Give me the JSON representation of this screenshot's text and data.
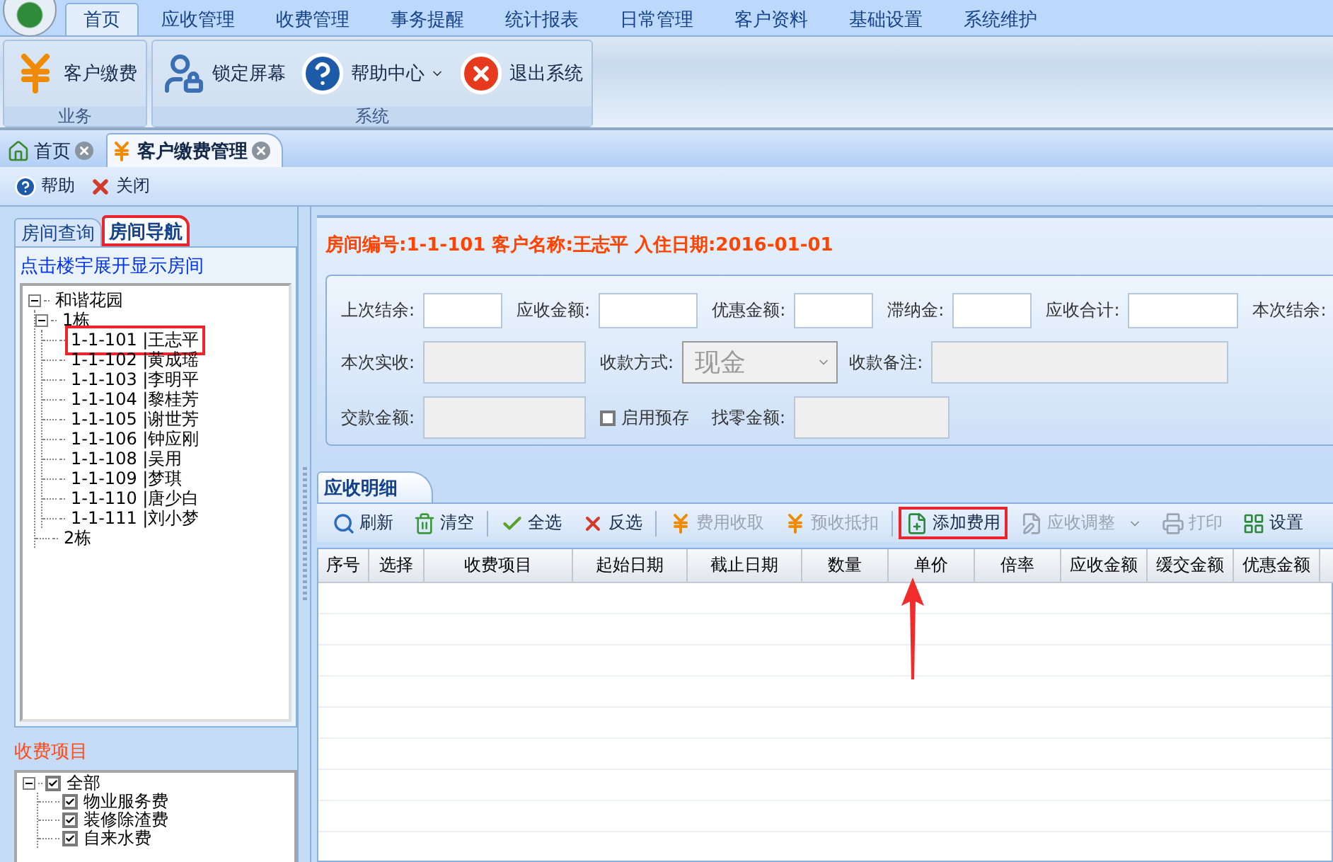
{
  "menu_tabs": [
    {
      "label": "首页",
      "selected": true
    },
    {
      "label": "应收管理",
      "selected": false
    },
    {
      "label": "收费管理",
      "selected": false
    },
    {
      "label": "事务提醒",
      "selected": false
    },
    {
      "label": "统计报表",
      "selected": false
    },
    {
      "label": "日常管理",
      "selected": false
    },
    {
      "label": "客户资料",
      "selected": false
    },
    {
      "label": "基础设置",
      "selected": false
    },
    {
      "label": "系统维护",
      "selected": false
    }
  ],
  "ribbon_groups": [
    {
      "title": "业务",
      "buttons": [
        {
          "label": "客户缴费",
          "dropdown": false
        }
      ]
    },
    {
      "title": "系统",
      "buttons": [
        {
          "label": "锁定屏幕",
          "dropdown": false
        },
        {
          "label": "帮助中心",
          "dropdown": true
        },
        {
          "label": "退出系统",
          "dropdown": false
        }
      ]
    }
  ],
  "doc_tabs": [
    {
      "label": "首页",
      "selected": false
    },
    {
      "label": "客户缴费管理",
      "selected": true
    }
  ],
  "page_toolbar": [
    {
      "label": "帮助"
    },
    {
      "label": "关闭"
    }
  ],
  "left_tabs": [
    {
      "label": "房间查询",
      "selected": false,
      "highlighted": false
    },
    {
      "label": "房间导航",
      "selected": true,
      "highlighted": true
    }
  ],
  "nav_hint": "点击楼宇展开显示房间",
  "room_tree": [
    {
      "label": "和谐花园",
      "expanded": true,
      "children": [
        {
          "label": "1栋",
          "expanded": true,
          "children": [
            {
              "label": "1-1-101 |王志平",
              "highlighted": true
            },
            {
              "label": "1-1-102 |黄成瑶",
              "highlighted": false
            },
            {
              "label": "1-1-103 |李明平",
              "highlighted": false
            },
            {
              "label": "1-1-104 |黎桂芳",
              "highlighted": false
            },
            {
              "label": "1-1-105 |谢世芳",
              "highlighted": false
            },
            {
              "label": "1-1-106 |钟应刚",
              "highlighted": false
            },
            {
              "label": "1-1-108 |吴用",
              "highlighted": false
            },
            {
              "label": "1-1-109 |梦琪",
              "highlighted": false
            },
            {
              "label": "1-1-110 |唐少白",
              "highlighted": false
            },
            {
              "label": "1-1-111 |刘小梦",
              "highlighted": false
            }
          ]
        },
        {
          "label": "2栋"
        }
      ]
    }
  ],
  "fee_items_title": "收费项目",
  "fee_tree": [
    {
      "label": "全部",
      "checked": true,
      "expanded": true,
      "children": [
        {
          "label": "物业服务费",
          "checked": true
        },
        {
          "label": "装修除渣费",
          "checked": true
        },
        {
          "label": "自来水费",
          "checked": true
        }
      ]
    }
  ],
  "info_line": "房间编号:1-1-101 客户名称:王志平 入住日期:2016-01-01",
  "form_rows": [
    [
      {
        "kind": "input",
        "label": "上次结余:",
        "disabled": false
      },
      {
        "kind": "input",
        "label": "应收金额:",
        "disabled": false
      },
      {
        "kind": "input",
        "label": "优惠金额:",
        "disabled": false
      },
      {
        "kind": "input",
        "label": "滞纳金:",
        "disabled": false
      },
      {
        "kind": "input",
        "label": "应收合计:",
        "disabled": false
      },
      {
        "kind": "label",
        "label": "本次结余:"
      }
    ],
    [
      {
        "kind": "input",
        "label": "本次实收:",
        "disabled": true
      },
      {
        "kind": "select",
        "label": "收款方式:",
        "value": "现金",
        "disabled": true
      },
      {
        "kind": "input",
        "label": "收款备注:",
        "disabled": true
      }
    ],
    [
      {
        "kind": "input",
        "label": "交款金额:",
        "disabled": true
      },
      {
        "kind": "checkbox",
        "label": "启用预存",
        "checked": false
      },
      {
        "kind": "input",
        "label": "找零金额:",
        "disabled": true
      }
    ]
  ],
  "detail_tab": "应收明细",
  "detail_toolbar": [
    {
      "kind": "button",
      "label": "刷新",
      "disabled": false,
      "highlighted": false,
      "dropdown": false
    },
    {
      "kind": "button",
      "label": "清空",
      "disabled": false,
      "highlighted": false,
      "dropdown": false
    },
    {
      "kind": "separator"
    },
    {
      "kind": "button",
      "label": "全选",
      "disabled": false,
      "highlighted": false,
      "dropdown": false
    },
    {
      "kind": "button",
      "label": "反选",
      "disabled": false,
      "highlighted": false,
      "dropdown": false
    },
    {
      "kind": "separator"
    },
    {
      "kind": "button",
      "label": "费用收取",
      "disabled": true,
      "highlighted": false,
      "dropdown": false
    },
    {
      "kind": "button",
      "label": "预收抵扣",
      "disabled": true,
      "highlighted": false,
      "dropdown": false
    },
    {
      "kind": "separator"
    },
    {
      "kind": "button",
      "label": "添加费用",
      "disabled": false,
      "highlighted": true,
      "dropdown": false
    },
    {
      "kind": "button",
      "label": "应收调整",
      "disabled": true,
      "highlighted": false,
      "dropdown": true
    },
    {
      "kind": "button",
      "label": "打印",
      "disabled": true,
      "highlighted": false,
      "dropdown": false
    },
    {
      "kind": "button",
      "label": "设置",
      "disabled": false,
      "highlighted": false,
      "dropdown": false
    }
  ],
  "table": {
    "columns": [
      "序号",
      "选择",
      "收费项目",
      "起始日期",
      "截止日期",
      "数量",
      "单价",
      "倍率",
      "应收金额",
      "缓交金额",
      "优惠金额"
    ]
  }
}
